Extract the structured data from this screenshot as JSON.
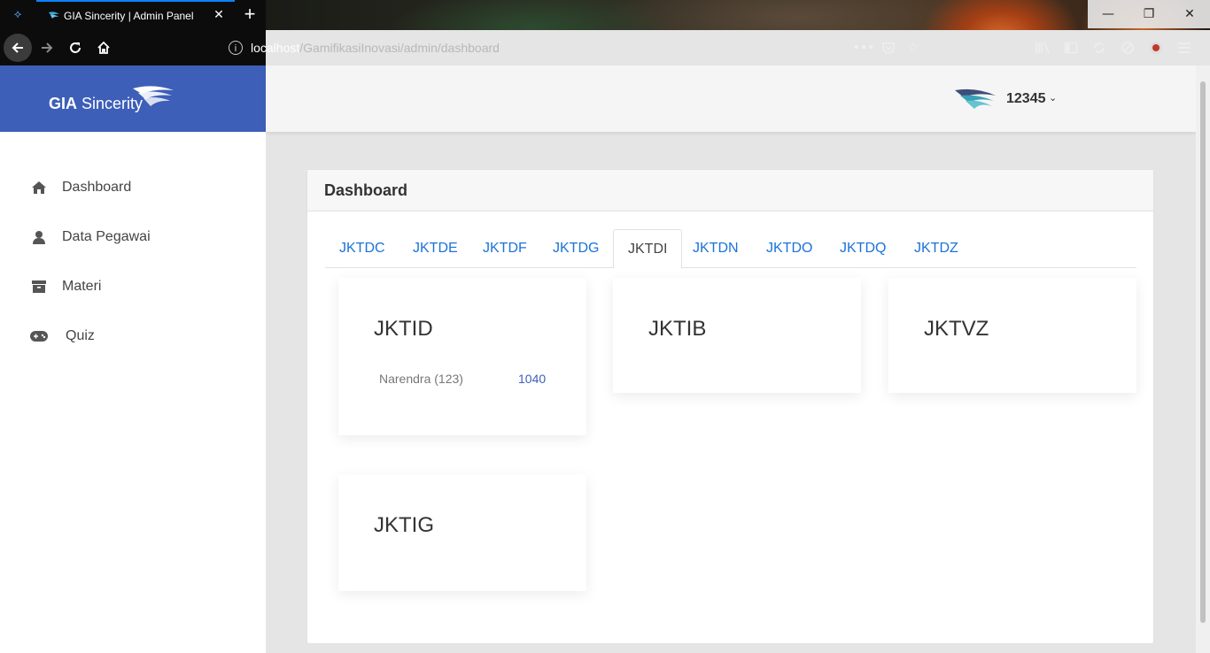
{
  "browser": {
    "tab_title": "GIA Sincerity | Admin Panel",
    "url_host": "localhost",
    "url_path": "/GamifikasiInovasi/admin/dashboard",
    "accent_color": "#0a84ff"
  },
  "brand": {
    "name_bold": "GIA",
    "name_rest": " Sincerity",
    "color": "#3d5fb8"
  },
  "sidebar": {
    "items": [
      {
        "label": "Dashboard",
        "icon": "home-icon"
      },
      {
        "label": "Data Pegawai",
        "icon": "user-icon"
      },
      {
        "label": "Materi",
        "icon": "archive-icon"
      },
      {
        "label": "Quiz",
        "icon": "gamepad-icon"
      }
    ]
  },
  "header": {
    "username": "12345"
  },
  "dashboard": {
    "title": "Dashboard",
    "tabs": [
      "JKTDC",
      "JKTDE",
      "JKTDF",
      "JKTDG",
      "JKTDI",
      "JKTDN",
      "JKTDO",
      "JKTDQ",
      "JKTDZ"
    ],
    "active_tab": "JKTDI",
    "units": [
      {
        "name": "JKTID",
        "rows": [
          {
            "employee": "Narendra (123)",
            "score": "1040"
          }
        ]
      },
      {
        "name": "JKTIB",
        "rows": []
      },
      {
        "name": "JKTVZ",
        "rows": []
      },
      {
        "name": "JKTIG",
        "rows": []
      }
    ]
  }
}
